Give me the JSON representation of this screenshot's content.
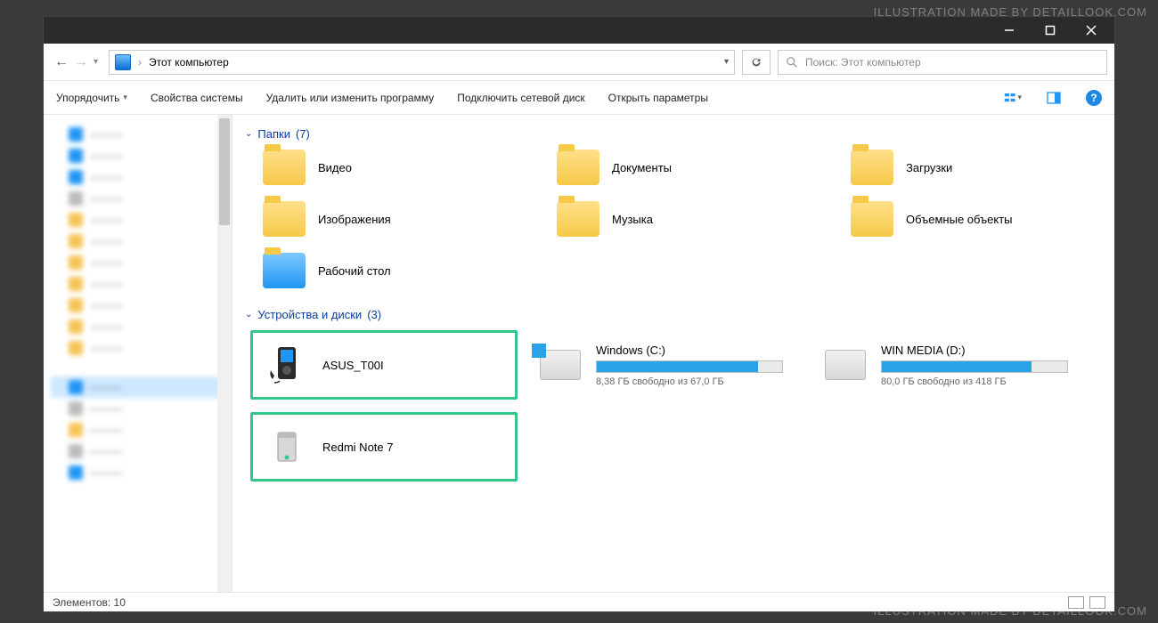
{
  "watermark": "ILLUSTRATION MADE BY DETAILLOOK.COM",
  "titlebar": {},
  "address": {
    "location": "Этот компьютер"
  },
  "search": {
    "placeholder": "Поиск: Этот компьютер"
  },
  "toolbar": {
    "organize": "Упорядочить",
    "system_props": "Свойства системы",
    "uninstall": "Удалить или изменить программу",
    "map_drive": "Подключить сетевой диск",
    "open_settings": "Открыть параметры"
  },
  "groups": {
    "folders": {
      "title": "Папки",
      "count": "(7)"
    },
    "devices": {
      "title": "Устройства и диски",
      "count": "(3)"
    }
  },
  "folders": [
    {
      "label": "Видео"
    },
    {
      "label": "Документы"
    },
    {
      "label": "Загрузки"
    },
    {
      "label": "Изображения"
    },
    {
      "label": "Музыка"
    },
    {
      "label": "Объемные объекты"
    },
    {
      "label": "Рабочий стол"
    }
  ],
  "devices": {
    "asus": {
      "label": "ASUS_T00I"
    },
    "drive_c": {
      "label": "Windows (C:)",
      "sub": "8,38 ГБ свободно из 67,0 ГБ",
      "fill_pct": 87
    },
    "drive_d": {
      "label": "WIN MEDIA (D:)",
      "sub": "80,0 ГБ свободно из 418 ГБ",
      "fill_pct": 81
    },
    "redmi": {
      "label": "Redmi Note 7"
    }
  },
  "status": {
    "elements": "Элементов: 10"
  }
}
